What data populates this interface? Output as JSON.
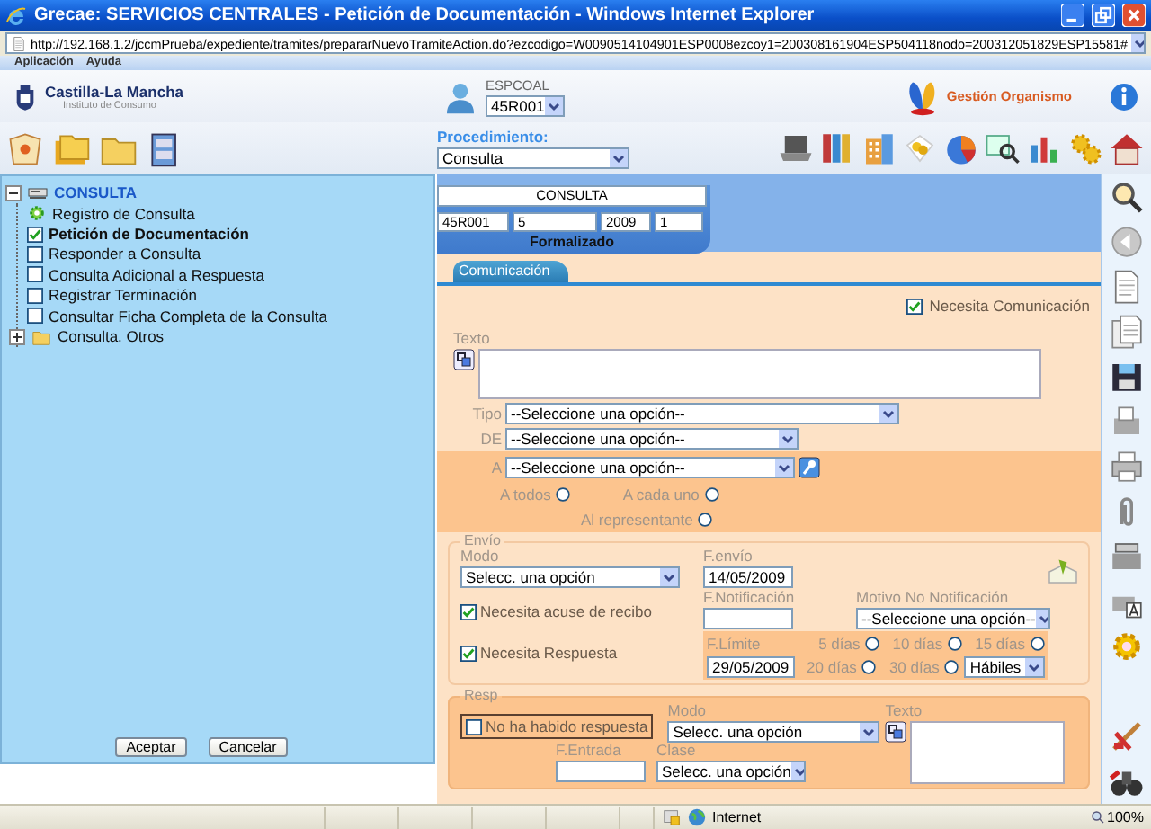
{
  "window": {
    "title": "Grecae: SERVICIOS CENTRALES - Petición de Documentación - Windows Internet Explorer"
  },
  "address_bar": {
    "url": "http://192.168.1.2/jccmPrueba/expediente/tramites/prepararNuevoTramiteAction.do?ezcodigo=W0090514104901ESP0008ezcoy1=200308161904ESP504118nodo=200312051829ESP15581#"
  },
  "menu": [
    {
      "label": "Aplicación"
    },
    {
      "label": "Ayuda"
    }
  ],
  "header": {
    "brand": "Castilla-La Mancha",
    "subtitle": "Instituto de Consumo",
    "user": "ESPCOAL",
    "office": "45R001",
    "module": "Gestión Organismo"
  },
  "toolbar": {
    "procedure_label": "Procedimiento:",
    "procedure": "Consulta"
  },
  "tree": {
    "label": "CONSULTA",
    "expanded": true,
    "children": [
      {
        "kind": "done",
        "label": "Registro de Consulta",
        "selected": false
      },
      {
        "kind": "task",
        "label": "Petición de Documentación",
        "checked": true,
        "selected": true
      },
      {
        "kind": "task",
        "label": "Responder a Consulta",
        "checked": false,
        "selected": false
      },
      {
        "kind": "task",
        "label": "Consulta Adicional a Respuesta",
        "checked": false,
        "selected": false
      },
      {
        "kind": "task",
        "label": "Registrar Terminación",
        "checked": false,
        "selected": false
      },
      {
        "kind": "task",
        "label": "Consultar Ficha Completa de la Consulta",
        "checked": false,
        "selected": false
      },
      {
        "kind": "folder",
        "label": "Consulta. Otros",
        "expanded": false,
        "selected": false
      }
    ]
  },
  "panel_buttons": [
    {
      "label": "Aceptar"
    },
    {
      "label": "Cancelar"
    }
  ],
  "record": {
    "title": "CONSULTA",
    "fields": [
      "45R001",
      "5",
      "2009",
      "1"
    ],
    "status": "Formalizado"
  },
  "tabs": [
    {
      "label": "Comunicación",
      "selected": true
    }
  ],
  "comunicacion": {
    "necesita": {
      "label": "Necesita Comunicación",
      "checked": true
    },
    "texto_label": "Texto",
    "tipo": {
      "label": "Tipo",
      "value": "--Seleccione una opción--"
    },
    "de": {
      "label": "DE",
      "value": "--Seleccione una opción--"
    },
    "a": {
      "label": "A",
      "value": "--Seleccione una opción--"
    },
    "recipients": [
      {
        "label": "A todos",
        "selected": false
      },
      {
        "label": "A cada uno",
        "selected": false
      },
      {
        "label": "Al representante",
        "selected": false
      }
    ]
  },
  "envio": {
    "legend": "Envío",
    "modo_label": "Modo",
    "modo": "Selecc. una opción",
    "f_envio_label": "F.envío",
    "f_envio": "14/05/2009",
    "acuse": {
      "label": "Necesita acuse de recibo",
      "checked": true
    },
    "respuesta": {
      "label": "Necesita Respuesta",
      "checked": true
    },
    "f_notificacion_label": "F.Notificación",
    "motivo_label": "Motivo No Notificación",
    "motivo": "--Seleccione una opción--",
    "f_limite_label": "F.Límite",
    "f_limite": "29/05/2009",
    "plazos": [
      {
        "label": "5 días",
        "selected": false
      },
      {
        "label": "10 días",
        "selected": false
      },
      {
        "label": "15 días",
        "selected": false
      },
      {
        "label": "20 días",
        "selected": false
      },
      {
        "label": "30 días",
        "selected": false
      }
    ],
    "dias_tipo": "Hábiles"
  },
  "resp": {
    "legend": "Resp",
    "no_respuesta": {
      "label": "No ha habido respuesta",
      "checked": false
    },
    "modo_label": "Modo",
    "modo": "Selecc. una opción",
    "texto_label": "Texto",
    "f_entrada_label": "F.Entrada",
    "clase_label": "Clase",
    "clase": "Selecc. una opción"
  },
  "status_bar": {
    "zone": "Internet",
    "zoom": "100%"
  }
}
